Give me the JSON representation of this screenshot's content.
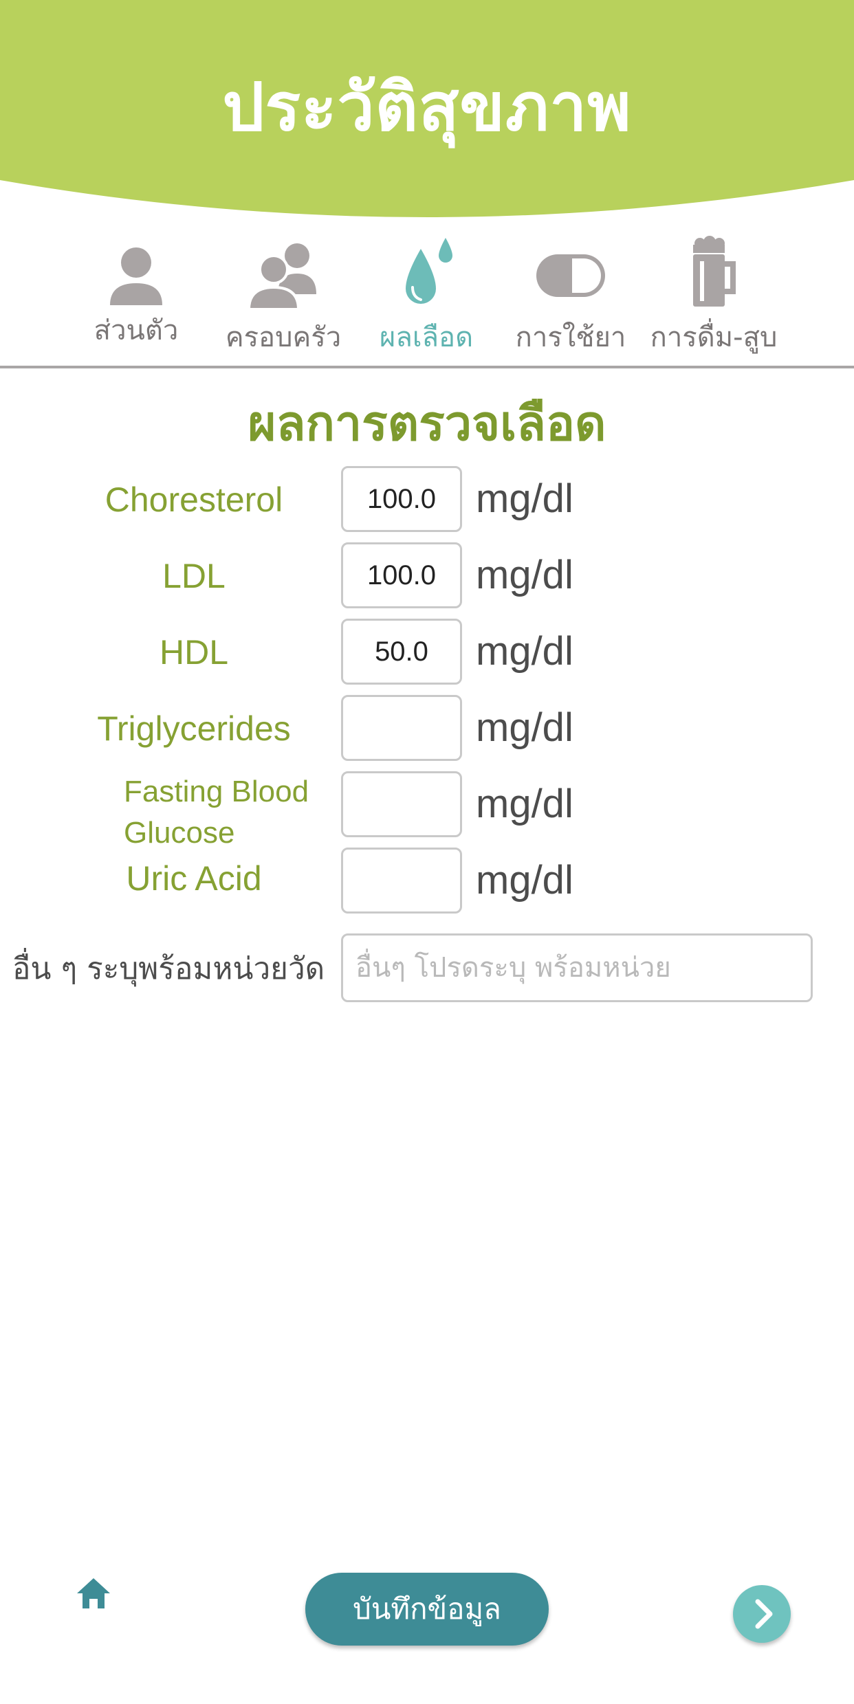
{
  "header": {
    "title": "ประวัติสุขภาพ"
  },
  "tabs": [
    {
      "label": "ส่วนตัว",
      "icon": "person-icon"
    },
    {
      "label": "ครอบครัว",
      "icon": "family-icon"
    },
    {
      "label": "ผลเลือด",
      "icon": "blood-drop-icon",
      "active": true
    },
    {
      "label": "การใช้ยา",
      "icon": "pill-icon"
    },
    {
      "label": "การดื่ม-สูบ",
      "icon": "beer-mug-icon"
    }
  ],
  "section": {
    "title": "ผลการตรวจเลือด"
  },
  "fields": [
    {
      "name": "Choresterol",
      "value": "100.0",
      "unit": "mg/dl"
    },
    {
      "name": "LDL",
      "value": "100.0",
      "unit": "mg/dl"
    },
    {
      "name": "HDL",
      "value": "50.0",
      "unit": "mg/dl"
    },
    {
      "name": "Triglycerides",
      "value": "",
      "unit": "mg/dl"
    },
    {
      "name": "Fasting Blood Glucose",
      "value": "",
      "unit": "mg/dl"
    },
    {
      "name": "Uric Acid",
      "value": "",
      "unit": "mg/dl"
    }
  ],
  "other": {
    "label": "อื่น ๆ ระบุพร้อมหน่วยวัด",
    "placeholder": "อื่นๆ โปรดระบุ พร้อมหน่วย"
  },
  "footer": {
    "save_label": "บันทึกข้อมูล"
  },
  "colors": {
    "header_green": "#b8d15c",
    "title_green": "#7d9a2e",
    "active_teal": "#5eb3b0",
    "button_teal": "#3e8c96"
  }
}
